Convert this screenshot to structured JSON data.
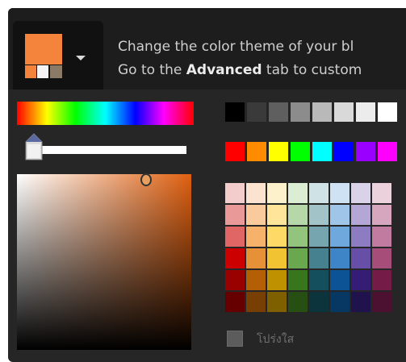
{
  "description": {
    "line1": "Change the color theme of your bl",
    "line2_prefix": "Go to the ",
    "line2_bold": "Advanced",
    "line2_suffix": " tab to custom"
  },
  "theme_button": {
    "icon": "chevron-down-icon",
    "main_color": "#f4843c",
    "sub_colors": [
      "#f4843c",
      "#f4f4f4",
      "#8a7a66"
    ]
  },
  "color_picker": {
    "selected_hue_color": "#e06010",
    "alpha_percent": 0
  },
  "grayscale_row": [
    "#000000",
    "#3a3a3a",
    "#5f5f5f",
    "#8c8c8c",
    "#b9b9b9",
    "#d9d9d9",
    "#ececec",
    "#ffffff"
  ],
  "bright_row": [
    "#ff0000",
    "#ff8c00",
    "#ffff00",
    "#00ff00",
    "#00ffff",
    "#0000ff",
    "#9900ff",
    "#ff00ff"
  ],
  "palette": [
    [
      "#f3cccc",
      "#fbe3cf",
      "#fdf1cc",
      "#dbeed4",
      "#cfe2e6",
      "#cfe2f3",
      "#d9d2e9",
      "#ead1dc"
    ],
    [
      "#ea9999",
      "#f9cb9c",
      "#ffe599",
      "#b6d7a8",
      "#a2c4c9",
      "#9fc5e8",
      "#b4a7d6",
      "#d5a6bd"
    ],
    [
      "#e06666",
      "#f6b26b",
      "#ffd966",
      "#93c47d",
      "#76a5af",
      "#6fa8dc",
      "#8e7cc3",
      "#c27ba0"
    ],
    [
      "#cc0000",
      "#e69138",
      "#f1c232",
      "#6aa84f",
      "#45818e",
      "#3d85c6",
      "#674ea7",
      "#a64d79"
    ],
    [
      "#990000",
      "#b45f06",
      "#bf9000",
      "#38761d",
      "#134f5c",
      "#0b5394",
      "#351c75",
      "#741b47"
    ],
    [
      "#660000",
      "#783f04",
      "#7f6000",
      "#274e13",
      "#0c343d",
      "#073763",
      "#20124d",
      "#4c1130"
    ]
  ],
  "transparent_label": "โปร่งใส"
}
